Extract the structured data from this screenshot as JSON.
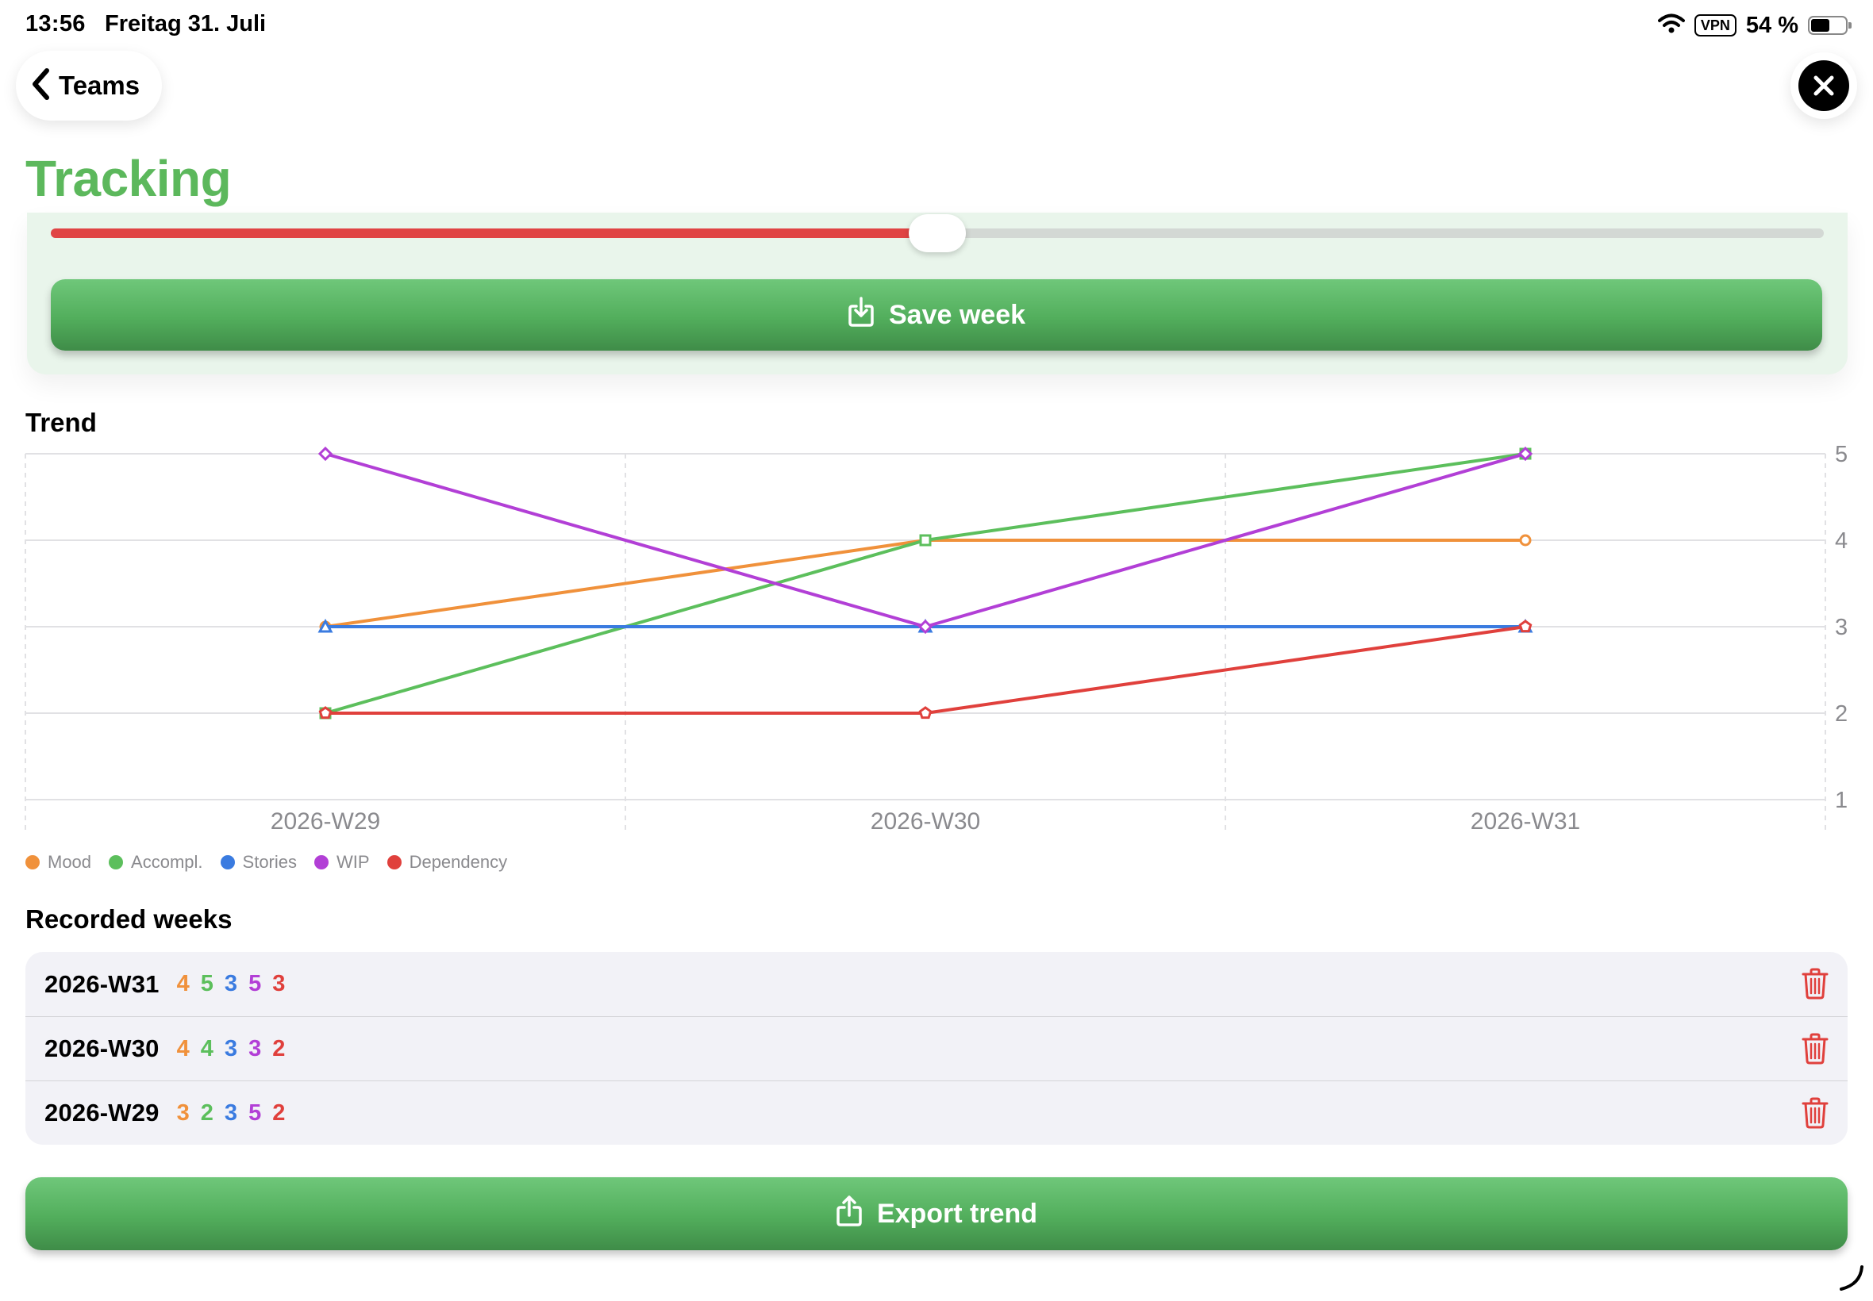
{
  "status": {
    "time": "13:56",
    "date": "Freitag 31. Juli",
    "vpn": "VPN",
    "battery": "54 %",
    "battery_level": 0.54
  },
  "nav": {
    "back_label": "Teams",
    "title": "Tracking"
  },
  "tracking": {
    "slider_fraction": 0.5,
    "save_label": "Save week"
  },
  "trend": {
    "title": "Trend"
  },
  "chart_data": {
    "type": "line",
    "x": [
      "2026-W29",
      "2026-W30",
      "2026-W31"
    ],
    "yticks": [
      "1",
      "2",
      "3",
      "4",
      "5"
    ],
    "ylim": [
      1,
      5
    ],
    "grid": true,
    "legend": "bottom-left",
    "series": [
      {
        "name": "Mood",
        "color": "#f0913b",
        "values": [
          3,
          4,
          4
        ]
      },
      {
        "name": "Accompl.",
        "color": "#5cbf5c",
        "values": [
          2,
          4,
          5
        ]
      },
      {
        "name": "Stories",
        "color": "#3a7be0",
        "values": [
          3,
          3,
          3
        ]
      },
      {
        "name": "WIP",
        "color": "#b23fd6",
        "values": [
          5,
          3,
          5
        ]
      },
      {
        "name": "Dependency",
        "color": "#e0403c",
        "values": [
          2,
          2,
          3
        ]
      }
    ]
  },
  "recorded": {
    "title": "Recorded weeks",
    "rows": [
      {
        "week": "2026-W31",
        "values": [
          "4",
          "5",
          "3",
          "5",
          "3"
        ]
      },
      {
        "week": "2026-W30",
        "values": [
          "4",
          "4",
          "3",
          "3",
          "2"
        ]
      },
      {
        "week": "2026-W29",
        "values": [
          "3",
          "2",
          "3",
          "5",
          "2"
        ]
      }
    ]
  },
  "export_label": "Export trend",
  "colors": {
    "accent": "#5cb85c",
    "danger": "#e0403c"
  }
}
